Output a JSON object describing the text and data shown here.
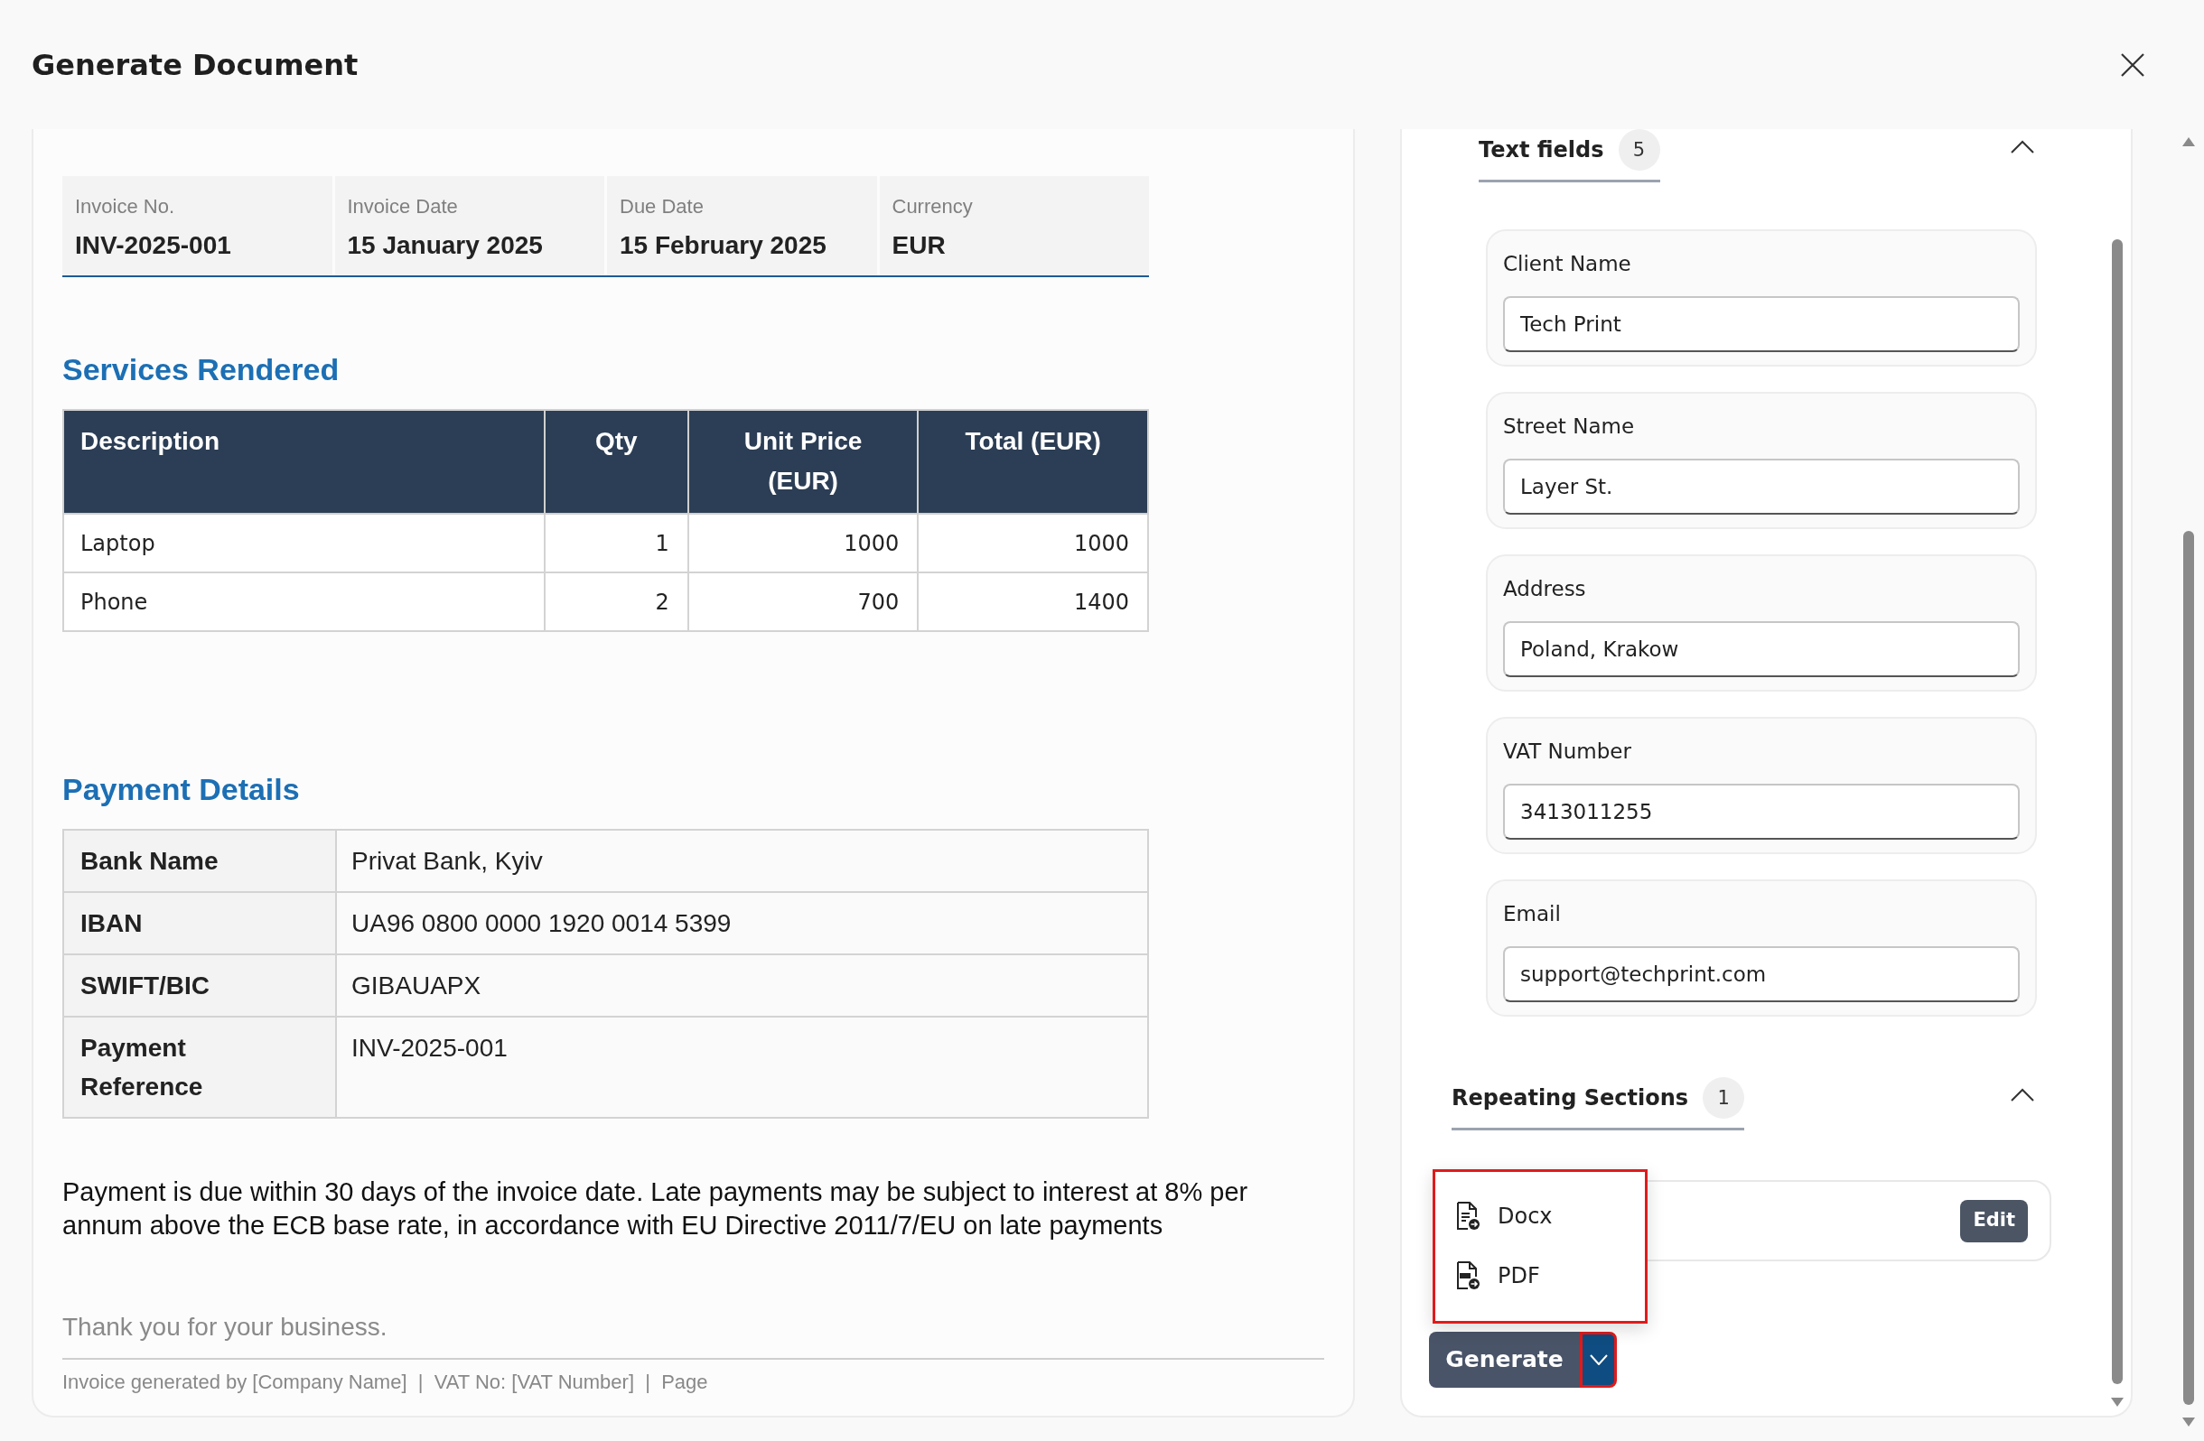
{
  "window": {
    "title": "Generate Document"
  },
  "preview": {
    "invoice_info": [
      {
        "label": "Invoice No.",
        "value": "INV-2025-001"
      },
      {
        "label": "Invoice Date",
        "value": "15 January 2025"
      },
      {
        "label": "Due Date",
        "value": "15 February 2025"
      },
      {
        "label": "Currency",
        "value": "EUR"
      }
    ],
    "services": {
      "heading": "Services Rendered",
      "columns": [
        "Description",
        "Qty",
        "Unit Price (EUR)",
        "Total (EUR)"
      ],
      "rows": [
        [
          "Laptop",
          "1",
          "1000",
          "1000"
        ],
        [
          "Phone",
          "2",
          "700",
          "1400"
        ]
      ]
    },
    "payment": {
      "heading": "Payment Details",
      "rows": [
        {
          "label": "Bank Name",
          "value": "Privat Bank, Kyiv"
        },
        {
          "label": "IBAN",
          "value": "UA96 0800 0000 1920 0014 5399"
        },
        {
          "label": "SWIFT/BIC",
          "value": "GIBAUAPX"
        },
        {
          "label": "Payment Reference",
          "value": "INV-2025-001"
        }
      ]
    },
    "terms": "Payment is due within 30 days of the invoice date. Late payments may be subject to interest at 8% per annum above the ECB base rate, in accordance with EU Directive 2011/7/EU on late payments",
    "thanks": "Thank you for your business.",
    "footer": "Invoice generated by [Company Name]  |  VAT No: [VAT Number]  |  Page"
  },
  "form": {
    "sections": [
      {
        "kind": "fields",
        "title": "Text fields",
        "count": "5",
        "expanded": true,
        "fields": [
          {
            "label": "Client Name",
            "value": "Tech Print"
          },
          {
            "label": "Street Name",
            "value": "Layer St."
          },
          {
            "label": "Address",
            "value": "Poland, Krakow"
          },
          {
            "label": "VAT Number",
            "value": "3413011255"
          },
          {
            "label": "Email",
            "value": "support@techprint.com"
          }
        ]
      },
      {
        "kind": "repeating",
        "title": "Repeating Sections",
        "count": "1",
        "expanded": true,
        "items": [
          {
            "button": "Edit"
          }
        ]
      }
    ]
  },
  "generate": {
    "label": "Generate",
    "menu_open": true,
    "menu": [
      {
        "kind": "docx",
        "label": "Docx"
      },
      {
        "kind": "pdf",
        "label": "PDF"
      }
    ]
  }
}
